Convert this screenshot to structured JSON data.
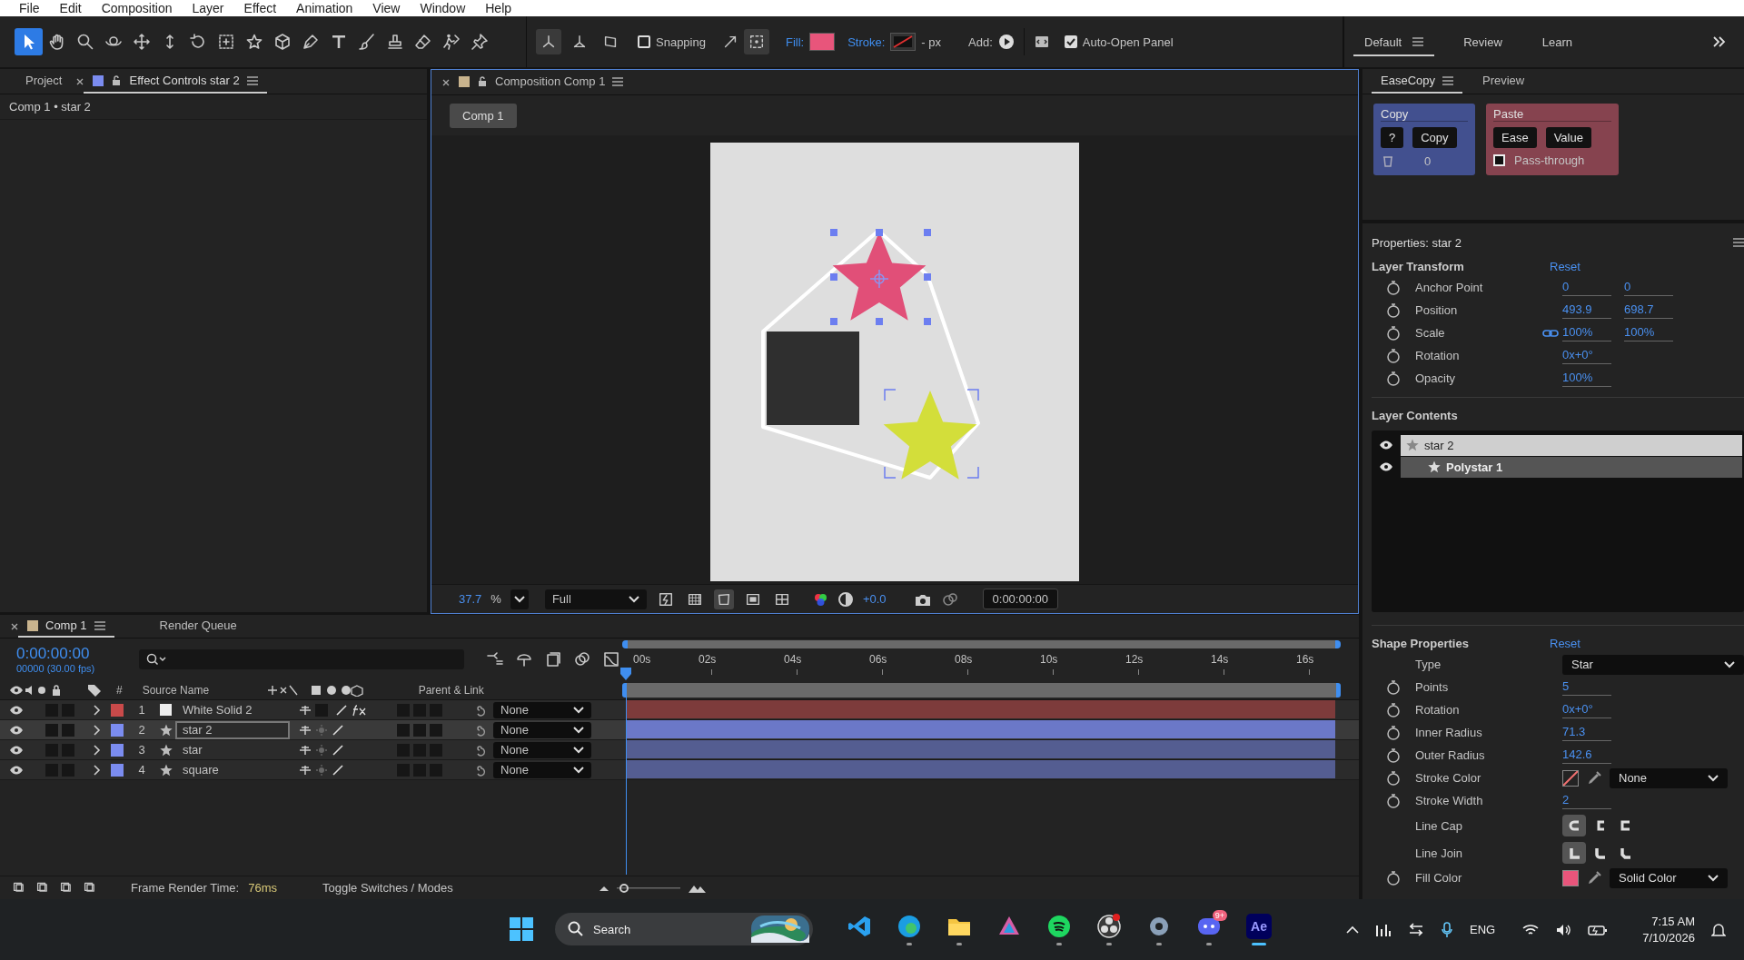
{
  "menu": [
    "File",
    "Edit",
    "Composition",
    "Layer",
    "Effect",
    "Animation",
    "View",
    "Window",
    "Help"
  ],
  "toolbar": {
    "tools": [
      {
        "kind": "selection",
        "selected": true
      },
      {
        "kind": "hand",
        "selected": false
      },
      {
        "kind": "zoom",
        "selected": false
      },
      {
        "kind": "orbit",
        "selected": false
      },
      {
        "kind": "pan",
        "selected": false
      },
      {
        "kind": "dolly",
        "selected": false
      },
      {
        "kind": "rotate",
        "selected": false
      },
      {
        "kind": "anchor",
        "selected": false
      },
      {
        "kind": "star",
        "selected": false
      },
      {
        "kind": "cube",
        "selected": false
      },
      {
        "kind": "pen",
        "selected": false
      },
      {
        "kind": "text",
        "selected": false
      },
      {
        "kind": "brush",
        "selected": false
      },
      {
        "kind": "stamp",
        "selected": false
      },
      {
        "kind": "eraser",
        "selected": false
      },
      {
        "kind": "puppet",
        "selected": false
      },
      {
        "kind": "pin",
        "selected": false
      }
    ],
    "snapping": {
      "label": "Snapping",
      "checked": false
    },
    "fill": {
      "label": "Fill:",
      "color": "#e8557b"
    },
    "stroke": {
      "label": "Stroke:",
      "value": "- px"
    },
    "add": {
      "label": "Add:"
    },
    "auto_open": {
      "label": "Auto-Open Panel",
      "checked": true
    }
  },
  "workspaces": [
    {
      "label": "Default",
      "selected": true
    },
    {
      "label": "Review",
      "selected": false
    },
    {
      "label": "Learn",
      "selected": false
    }
  ],
  "left_panel": {
    "tabs": [
      {
        "label": "Project",
        "selected": false
      },
      {
        "label": "Effect Controls star 2",
        "selected": true
      }
    ],
    "subtitle": "Comp 1 • star 2"
  },
  "composition": {
    "tab": "Composition Comp 1",
    "breadcrumb": "Comp 1",
    "zoom": "37.7",
    "zoom_unit": "%",
    "resolution": "Full",
    "exposure": "+0.0",
    "timecode": "0:00:00:00"
  },
  "timeline": {
    "tabs": [
      {
        "label": "Comp 1",
        "selected": true
      },
      {
        "label": "Render Queue",
        "selected": false
      }
    ],
    "timecode": "0:00:00:00",
    "fps": "00000 (30.00 fps)",
    "columns": [
      "#",
      "Source Name",
      "Parent & Link"
    ],
    "ruler": [
      "00s",
      "02s",
      "04s",
      "06s",
      "08s",
      "10s",
      "12s",
      "14s",
      "16s"
    ],
    "layers": [
      {
        "number": "1",
        "name": "White Solid 2",
        "kind": "solid",
        "color": "#c94a4a",
        "selected": false,
        "fx": true,
        "parent": "None"
      },
      {
        "number": "2",
        "name": "star 2",
        "kind": "shape",
        "color": "#7b8cf0",
        "selected": true,
        "fx": false,
        "parent": "None"
      },
      {
        "number": "3",
        "name": "star",
        "kind": "shape",
        "color": "#7b8cf0",
        "selected": false,
        "fx": false,
        "parent": "None"
      },
      {
        "number": "4",
        "name": "square",
        "kind": "shape",
        "color": "#7b8cf0",
        "selected": false,
        "fx": false,
        "parent": "None"
      }
    ],
    "zoom_slider": {
      "level": 0.05
    },
    "render_time_label": "Frame Render Time:",
    "render_time": "76ms",
    "toggle": "Toggle Switches / Modes"
  },
  "easecopy": {
    "tabs": [
      {
        "label": "EaseCopy",
        "selected": true
      },
      {
        "label": "Preview",
        "selected": false
      }
    ],
    "copy": {
      "title": "Copy",
      "help": "?",
      "button": "Copy",
      "count": "0"
    },
    "paste": {
      "title": "Paste",
      "buttons": [
        "Ease",
        "Value"
      ],
      "pass_through": {
        "label": "Pass-through",
        "checked": false
      }
    }
  },
  "properties": {
    "title": "Properties: star 2",
    "transform": {
      "title": "Layer Transform",
      "reset": "Reset",
      "rows": [
        {
          "label": "Anchor Point",
          "values": [
            "0",
            "0"
          ],
          "linked": false
        },
        {
          "label": "Position",
          "values": [
            "493.9",
            "698.7"
          ],
          "linked": false
        },
        {
          "label": "Scale",
          "values": [
            "100%",
            "100%"
          ],
          "linked": true
        },
        {
          "label": "Rotation",
          "values": [
            "0x+0°"
          ],
          "linked": false
        },
        {
          "label": "Opacity",
          "values": [
            "100%"
          ],
          "linked": false
        }
      ]
    },
    "contents": {
      "title": "Layer Contents",
      "items": [
        {
          "label": "star 2",
          "selected": true,
          "children": [
            {
              "label": "Polystar 1",
              "selected": false
            }
          ]
        }
      ]
    },
    "shape": {
      "title": "Shape Properties",
      "reset": "Reset",
      "rows": [
        {
          "kind": "dropdown",
          "label": "Type",
          "keyframeable": false,
          "value": "Star"
        },
        {
          "kind": "value",
          "label": "Points",
          "keyframeable": true,
          "value": "5"
        },
        {
          "kind": "value",
          "label": "Rotation",
          "keyframeable": true,
          "value": "0x+0°"
        },
        {
          "kind": "value",
          "label": "Inner Radius",
          "keyframeable": true,
          "value": "71.3"
        },
        {
          "kind": "value",
          "label": "Outer Radius",
          "keyframeable": true,
          "value": "142.6"
        },
        {
          "kind": "stroke_color",
          "label": "Stroke Color",
          "keyframeable": true,
          "value": "None"
        },
        {
          "kind": "value",
          "label": "Stroke Width",
          "keyframeable": true,
          "value": "2"
        },
        {
          "kind": "cap",
          "label": "Line Cap",
          "keyframeable": false,
          "options": [
            {
              "selected": true
            },
            {
              "selected": false
            },
            {
              "selected": false
            }
          ]
        },
        {
          "kind": "join",
          "label": "Line Join",
          "keyframeable": false,
          "options": [
            {
              "selected": true
            },
            {
              "selected": false
            },
            {
              "selected": false
            }
          ]
        },
        {
          "kind": "fill_color",
          "label": "Fill Color",
          "keyframeable": true,
          "color": "#e8557b",
          "value": "Solid Color"
        }
      ]
    }
  },
  "taskbar": {
    "search": "Search",
    "apps": [
      {
        "kind": "vscode",
        "running": false,
        "active": false
      },
      {
        "kind": "edge",
        "running": true,
        "active": false
      },
      {
        "kind": "folder",
        "running": true,
        "active": false
      },
      {
        "kind": "triangles",
        "running": false,
        "active": false
      },
      {
        "kind": "spotify",
        "running": true,
        "active": false
      },
      {
        "kind": "obs",
        "running": true,
        "active": false
      },
      {
        "kind": "gear",
        "running": true,
        "active": false
      },
      {
        "kind": "discord",
        "running": true,
        "active": false,
        "badge": "9+"
      },
      {
        "kind": "ae",
        "running": true,
        "active": true,
        "label": "Ae"
      }
    ],
    "language": "ENG",
    "time": "7:15 AM",
    "date": "7/10/2026"
  }
}
